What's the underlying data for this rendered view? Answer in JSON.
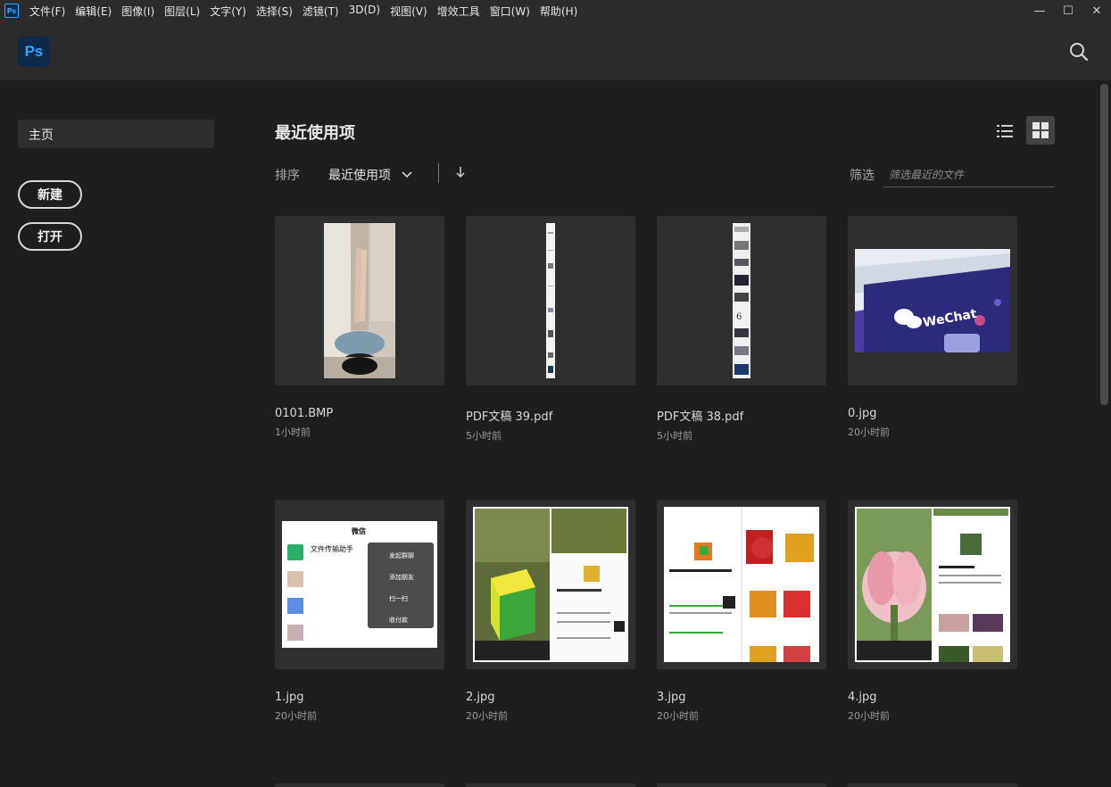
{
  "menubar": {
    "app_icon": "Ps",
    "items": [
      "文件(F)",
      "编辑(E)",
      "图像(I)",
      "图层(L)",
      "文字(Y)",
      "选择(S)",
      "滤镜(T)",
      "3D(D)",
      "视图(V)",
      "增效工具",
      "窗口(W)",
      "帮助(H)"
    ],
    "window_controls": {
      "minimize": "—",
      "maximize": "☐",
      "close": "✕"
    }
  },
  "header": {
    "logo": "Ps",
    "search_icon": "search-icon"
  },
  "sidebar": {
    "home_label": "主页",
    "new_label": "新建",
    "open_label": "打开"
  },
  "main": {
    "title": "最近使用项",
    "sort_label": "排序",
    "sort_value": "最近使用项",
    "filter_label": "筛选",
    "filter_placeholder": "筛选最近的文件",
    "files": [
      {
        "name": "0101.BMP",
        "time": "1小时前"
      },
      {
        "name": "PDF文稿 39.pdf",
        "time": "5小时前"
      },
      {
        "name": "PDF文稿 38.pdf",
        "time": "5小时前"
      },
      {
        "name": "0.jpg",
        "time": "20小时前"
      },
      {
        "name": "1.jpg",
        "time": "20小时前"
      },
      {
        "name": "2.jpg",
        "time": "20小时前"
      },
      {
        "name": "3.jpg",
        "time": "20小时前"
      },
      {
        "name": "4.jpg",
        "time": "20小时前"
      }
    ],
    "thumb_text": {
      "wechat_logo": "WeChat",
      "menu_title": "微信",
      "file_helper": "文件传输助手",
      "menu_items": [
        "发起群聊",
        "添加朋友",
        "扫一扫",
        "收付款"
      ]
    }
  },
  "colors": {
    "accent": "#31a8ff",
    "background": "#1e1e1e",
    "panel": "#2b2b2b",
    "card": "#2f2f2f"
  }
}
